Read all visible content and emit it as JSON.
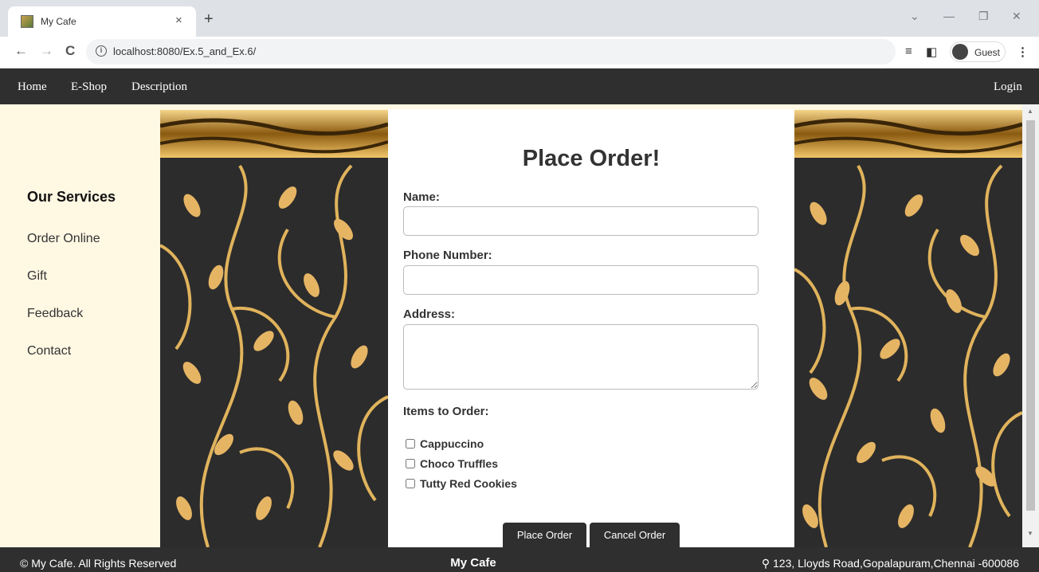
{
  "browser": {
    "tab_title": "My Cafe",
    "tab_close": "×",
    "new_tab": "+",
    "url": "localhost:8080/Ex.5_and_Ex.6/",
    "profile_label": "Guest",
    "back": "←",
    "forward": "→",
    "reload": "C",
    "minimize": "—",
    "restore": "❐",
    "close": "✕",
    "tabsearch": "⌄",
    "menu": "⋮"
  },
  "nav": {
    "home": "Home",
    "eshop": "E-Shop",
    "description": "Description",
    "login": "Login"
  },
  "sidebar": {
    "heading": "Our Services",
    "items": [
      "Order Online",
      "Gift",
      "Feedback",
      "Contact"
    ]
  },
  "form": {
    "title": "Place Order!",
    "name_label": "Name:",
    "phone_label": "Phone Number:",
    "address_label": "Address:",
    "items_label": "Items to Order:",
    "items": [
      "Cappuccino",
      "Choco Truffles",
      "Tutty Red Cookies"
    ],
    "place_button": "Place Order",
    "cancel_button": "Cancel Order"
  },
  "footer": {
    "copyright": "© My Cafe. All Rights Reserved",
    "brand": "My Cafe",
    "address": "123, Lloyds Road,Gopalapuram,Chennai -600086",
    "address_icon": "map-pin-icon"
  },
  "colors": {
    "nav_bg": "#2f2f2f",
    "page_bg": "#fff8e3",
    "gold": "#d9a54a"
  }
}
